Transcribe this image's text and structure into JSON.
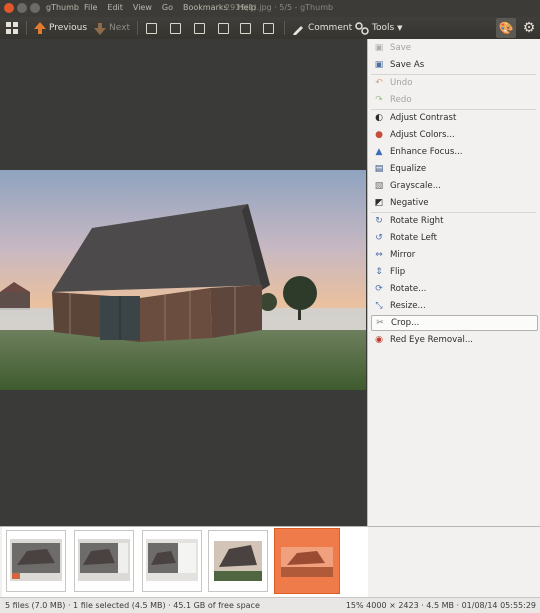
{
  "titlebar": {
    "app_name": "gThumb",
    "menu": [
      "File",
      "Edit",
      "View",
      "Go",
      "Bookmarks",
      "Help"
    ],
    "title_text": "2919(1).jpg · 5/5 - gThumb"
  },
  "toolbar": {
    "previous": "Previous",
    "next": "Next",
    "comment": "Comment",
    "tools": "Tools"
  },
  "tools_menu": {
    "items": [
      {
        "label": "Save",
        "icon": "save-icon",
        "disabled": true
      },
      {
        "label": "Save As",
        "icon": "save-as-icon",
        "disabled": false
      },
      {
        "label": "Undo",
        "icon": "undo-icon",
        "disabled": true
      },
      {
        "label": "Redo",
        "icon": "redo-icon",
        "disabled": true
      },
      {
        "label": "Adjust Contrast",
        "icon": "contrast-icon",
        "disabled": false
      },
      {
        "label": "Adjust Colors...",
        "icon": "colors-icon",
        "disabled": false
      },
      {
        "label": "Enhance Focus...",
        "icon": "focus-icon",
        "disabled": false
      },
      {
        "label": "Equalize",
        "icon": "equalize-icon",
        "disabled": false
      },
      {
        "label": "Grayscale...",
        "icon": "grayscale-icon",
        "disabled": false
      },
      {
        "label": "Negative",
        "icon": "negative-icon",
        "disabled": false
      },
      {
        "label": "Rotate Right",
        "icon": "rotate-right-icon",
        "disabled": false
      },
      {
        "label": "Rotate Left",
        "icon": "rotate-left-icon",
        "disabled": false
      },
      {
        "label": "Mirror",
        "icon": "mirror-icon",
        "disabled": false
      },
      {
        "label": "Flip",
        "icon": "flip-icon",
        "disabled": false
      },
      {
        "label": "Rotate...",
        "icon": "rotate-icon",
        "disabled": false
      },
      {
        "label": "Resize...",
        "icon": "resize-icon",
        "disabled": false
      },
      {
        "label": "Crop...",
        "icon": "crop-icon",
        "disabled": false
      },
      {
        "label": "Red Eye Removal...",
        "icon": "red-eye-icon",
        "disabled": false
      }
    ]
  },
  "statusbar": {
    "left": "5 files (7.0 MB) · 1 file selected (4.5 MB) · 45.1 GB of free space",
    "right": "15%  4000 × 2423 · 4.5 MB · 01/08/14 05:55:29"
  },
  "colors": {
    "accent": "#ef7a4a",
    "toolbar": "#3c3b37",
    "viewer_bg": "#3a3a38"
  }
}
